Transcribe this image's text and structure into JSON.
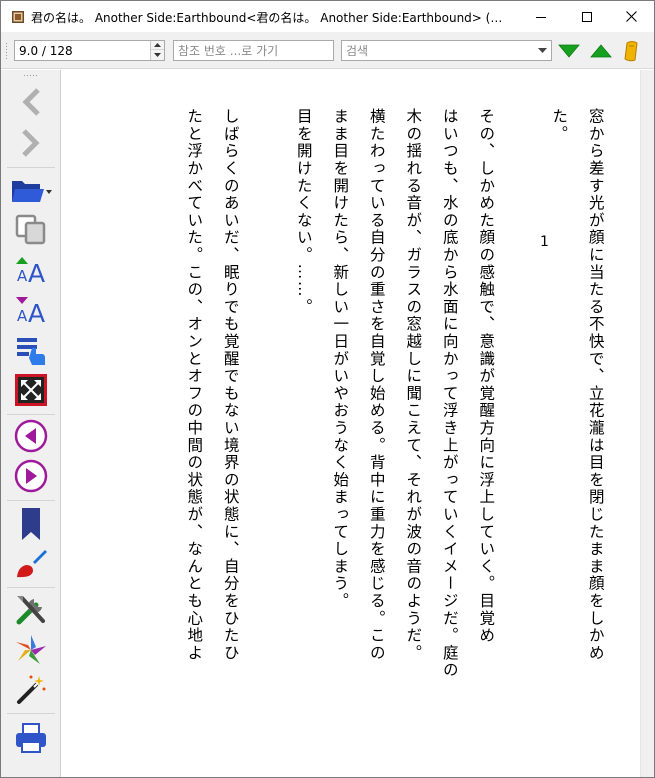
{
  "window": {
    "title": "君の名は。 Another Side:Earthbound<君の名は。 Another Side:Earthbound> (角川ス...",
    "icon": "book-app-icon"
  },
  "toolbar": {
    "page_value": "9.0 / 128",
    "ref_placeholder": "참조 번호 ...로 가기",
    "search_placeholder": "검색",
    "icons": [
      "search-dropdown-icon",
      "next-result-icon",
      "prev-result-icon",
      "bookmark-tool-icon"
    ],
    "colors": {
      "arrow_green": "#16a020",
      "bookmark_yellow": "#e0a800"
    }
  },
  "sidebar": {
    "buttons": [
      "back-icon",
      "forward-icon",
      "open-book-icon",
      "copy-icon",
      "increase-font-icon",
      "decrease-font-icon",
      "toc-icon",
      "fullscreen-icon",
      "previous-page-icon",
      "next-page-icon",
      "bookmark-icon",
      "theme-icon",
      "preferences-icon",
      "plugins-icon",
      "magic-icon",
      "print-icon"
    ],
    "colors": {
      "purple": "#9a1a9a",
      "navy": "#2e3c8c",
      "blue": "#1a6fd8",
      "red": "#c8102e"
    }
  },
  "reader": {
    "page_number": "1",
    "columns": [
      "窓から差す光が顔に当たる不快で、立花瀧は目を閉じたまま顔をしかめ",
      "た。",
      "",
      "その、しかめた顔の感触で、意識が覚醒方向に浮上していく。目覚め",
      "はいつも、水の底から水面に向かって浮き上がっていくイメージだ。庭の",
      "木の揺れる音が、ガラスの窓越しに聞こえて、それが波の音のようだ。",
      "横たわっている自分の重さを自覚し始める。背中に重力を感じる。この",
      "まま目を開けたら、新しい一日がいやおうなく始まってしまう。",
      "目を開けたくない。……。",
      "",
      "しばらくのあいだ、眠りでも覚醒でもない境界の状態に、自分をひたひ",
      "たと浮かべていた。この、オンとオフの中間の状態が、なんとも心地よ"
    ]
  }
}
